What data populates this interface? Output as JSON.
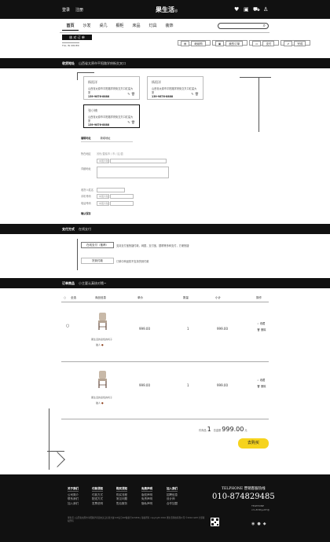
{
  "header": {
    "login": "登录",
    "register": "注册",
    "logo": "果生活",
    "logo_mark": "◎"
  },
  "nav": [
    "首页",
    "沙发",
    "桌几",
    "橱柜",
    "床品",
    "灯具",
    "装饰"
  ],
  "search": {
    "placeholder": ""
  },
  "order": {
    "title": "核 对 订 单",
    "fill": "FILL IN ORDER",
    "btns": [
      "继续购",
      "我的订单",
      "支付",
      "完成"
    ]
  },
  "address": {
    "bar_title": "收货地址",
    "bar_value": "山西省太原市平阳路学府街交叉口",
    "cards": [
      {
        "name": "杨阳洋",
        "line1": "山西省太原市平阳路学府街交叉口红星大厦",
        "line2": "",
        "phone": "139-9876-8888"
      },
      {
        "name": "杨阳洋",
        "line1": "山西省太原市平阳路学府街交叉口红星大厦",
        "line2": "",
        "phone": "139-9876-8888"
      },
      {
        "name": "张小楠",
        "line1": "山西省太原市平阳路学府街交叉口红星大厦",
        "line2": "",
        "phone": "139-9876-8888"
      }
    ],
    "tabs": [
      "编辑地址",
      "新增地址"
    ],
    "form": {
      "region_label": "所在地区",
      "region_hint": "省份/直辖市 / 市 / 区/县",
      "region_select": "中国大陆",
      "detail_label": "详细地址",
      "name_label": "收货人姓名",
      "phone_label": "手机号码",
      "tel_label": "电话号码",
      "phone_select": "中国大陆",
      "save": "确认保存"
    }
  },
  "payment": {
    "bar_title": "支付方式",
    "bar_value": "在线支付",
    "online": "在线支付（推荐）",
    "online_desc": "支持支付宝快捷付款，网银，支付宝，银联等多种支付，方便快捷",
    "cod": "货到付款",
    "cod_desc": "订单中商品暂不支持货到付款"
  },
  "cart": {
    "bar_title": "订单商品",
    "bar_value": "小主要认真核对哦~",
    "headers": [
      "全选",
      "商品信息",
      "单价",
      "数量",
      "小计",
      "操作"
    ],
    "items": [
      {
        "name": "黑生活的蓝色的椅子",
        "spec": "猫人",
        "price": "999.00",
        "qty": "1",
        "subtotal": "999.00",
        "op1": "收藏",
        "op2": "删除"
      },
      {
        "name": "黑生活的蓝色的椅子",
        "spec": "猫人",
        "price": "999.00",
        "qty": "1",
        "subtotal": "999.00",
        "op1": "收藏",
        "op2": "删除"
      }
    ],
    "count_label": "件商品",
    "count": "1",
    "total_label": "件商品",
    "amount_label": "总金额",
    "amount": "999.00",
    "unit": "元",
    "submit": "去购买"
  },
  "footer": {
    "cols": [
      {
        "h": "关于我们",
        "items": [
          "公司简介",
          "联系我们",
          "加入我们"
        ]
      },
      {
        "h": "付款须知",
        "items": [
          "付款方式",
          "配送方式",
          "发票说明"
        ]
      },
      {
        "h": "购买须知",
        "items": [
          "购买流程",
          "常见问题",
          "售后服务"
        ]
      },
      {
        "h": "免费声明",
        "items": [
          "版权声明",
          "免责声明",
          "隐私声明"
        ]
      },
      {
        "h": "加入我们",
        "items": [
          "招聘信息",
          "设计师",
          "合作加盟"
        ]
      }
    ],
    "tel_label": "TELPHONE 营销客服热线",
    "tel": "010-874829485",
    "tel_small": "TELPHONE",
    "email": "cm-874tyu87@",
    "legal": "果生活 | 山西省太原市平阳路学府街交叉口红星大厦 ICP证京ICP备案号123456 | 版权所有 copyright 2016 果生活科技有限公司 ©2016 GRH 全部版权所有"
  },
  "colors": {
    "accent": "#f6d31d",
    "dark": "#111111"
  }
}
